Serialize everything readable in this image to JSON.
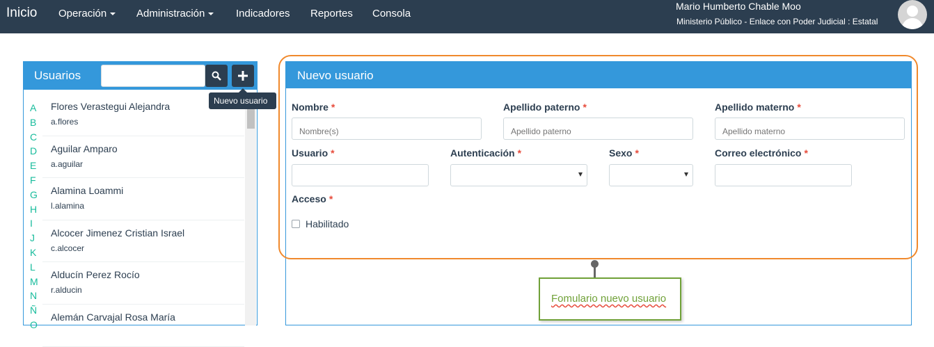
{
  "navbar": {
    "brand": "Inicio",
    "items": [
      {
        "label": "Operación",
        "dropdown": true
      },
      {
        "label": "Administración",
        "dropdown": true
      },
      {
        "label": "Indicadores",
        "dropdown": false
      },
      {
        "label": "Reportes",
        "dropdown": false
      },
      {
        "label": "Consola",
        "dropdown": false
      }
    ],
    "user": {
      "name": "Mario Humberto Chable Moo",
      "role": "Ministerio Público - Enlace con Poder Judicial : Estatal"
    }
  },
  "users_panel": {
    "title": "Usuarios",
    "search_value": "",
    "tooltip": "Nuevo usuario",
    "alphabet": [
      "A",
      "B",
      "C",
      "D",
      "E",
      "F",
      "G",
      "H",
      "I",
      "J",
      "K",
      "L",
      "M",
      "N",
      "Ñ",
      "O"
    ],
    "users": [
      {
        "name": "Flores Verastegui Alejandra",
        "login": "a.flores"
      },
      {
        "name": "Aguilar Amparo",
        "login": "a.aguilar"
      },
      {
        "name": "Alamina Loammi",
        "login": "l.alamina"
      },
      {
        "name": "Alcocer Jimenez Cristian Israel",
        "login": "c.alcocer"
      },
      {
        "name": "Alducín Perez Rocío",
        "login": "r.alducin"
      },
      {
        "name": "Alemán Carvajal Rosa María",
        "login": ""
      }
    ]
  },
  "form_panel": {
    "title": "Nuevo usuario",
    "fields": {
      "nombre": {
        "label": "Nombre",
        "placeholder": "Nombre(s)",
        "value": ""
      },
      "apellido_paterno": {
        "label": "Apellido paterno",
        "placeholder": "Apellido paterno",
        "value": ""
      },
      "apellido_materno": {
        "label": "Apellido materno",
        "placeholder": "Apellido materno",
        "value": ""
      },
      "usuario": {
        "label": "Usuario",
        "placeholder": "",
        "value": ""
      },
      "autenticacion": {
        "label": "Autenticación",
        "value": ""
      },
      "sexo": {
        "label": "Sexo",
        "value": ""
      },
      "correo": {
        "label": "Correo electrónico",
        "placeholder": "",
        "value": ""
      },
      "acceso": {
        "label": "Acceso",
        "checkbox_label": "Habilitado",
        "checked": false
      }
    },
    "required_mark": "*"
  },
  "annotation": {
    "text": "Fomulario nuevo usuario"
  },
  "colors": {
    "navbar": "#2c3e50",
    "panel_header": "#3498db",
    "required": "#e74c3c",
    "alphabet": "#18bc9c",
    "highlight": "#f0892c",
    "annotation": "#70a138"
  }
}
